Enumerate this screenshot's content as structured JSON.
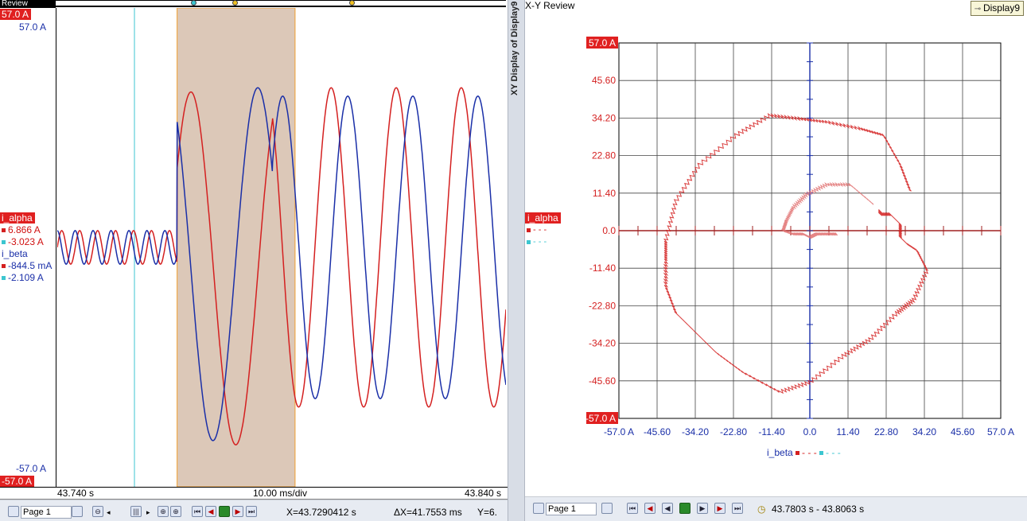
{
  "left_panel": {
    "tab_label": "Review",
    "scale_top_red": "57.0  A",
    "scale_top_blue": "57.0  A",
    "scale_bottom_blue": "-57.0  A",
    "scale_bottom_red": "-57.0  A",
    "channels": [
      {
        "name": "i_alpha",
        "value1": "6.866  A",
        "value2": "-3.023  A"
      },
      {
        "name": "i_beta",
        "value1": "-844.5 mA",
        "value2": "-2.109  A"
      }
    ],
    "time_start": "43.740 s",
    "time_div": "10.00 ms/div",
    "time_end": "43.840 s",
    "toolbar": {
      "page_label": "Page 1",
      "x_readout": "X=43.7290412 s",
      "dx_readout": "ΔX=41.7553 ms",
      "y_readout": "Y=6."
    }
  },
  "splitter": {
    "label": "XY Display of Display9 '"
  },
  "right_panel": {
    "title": "X-Y Review",
    "display_button": "Display9",
    "legend_channel": "i_alpha",
    "legend_dash": "- - -",
    "x_legend": "i_beta",
    "toolbar": {
      "page_label": "Page 1",
      "range_readout": "43.7803 s - 43.8063 s"
    }
  },
  "colors": {
    "alpha": "#d42020",
    "beta": "#1a2fa8",
    "cursor_cyan": "#3cc6d0",
    "selection": "#dcc8b8"
  },
  "chart_data": [
    {
      "type": "line",
      "x_range": [
        43.74,
        43.84
      ],
      "y_range": [
        -57,
        57
      ],
      "cursors": [
        {
          "t": 43.7572
        },
        {
          "t": 43.7667
        },
        {
          "t": 43.793
        }
      ],
      "selection": [
        43.7667,
        43.793
      ],
      "series": [
        {
          "name": "i_alpha",
          "color": "#d42020",
          "segments": [
            {
              "t0": 43.74,
              "t1": 43.7667,
              "amp": 4,
              "period": 0.004,
              "phase": 0.0,
              "offset": 0
            },
            {
              "t0": 43.7667,
              "t1": 43.788,
              "amp": 42,
              "period": 0.02,
              "phase": 0.6,
              "offset": -5
            },
            {
              "t0": 43.788,
              "t1": 43.84,
              "amp": 38,
              "period": 0.0145,
              "phase": 2.2,
              "offset": 0
            }
          ]
        },
        {
          "name": "i_beta",
          "color": "#1a2fa8",
          "segments": [
            {
              "t0": 43.74,
              "t1": 43.7667,
              "amp": 4,
              "period": 0.004,
              "phase": 1.6,
              "offset": 0
            },
            {
              "t0": 43.7667,
              "t1": 43.788,
              "amp": 42,
              "period": 0.02,
              "phase": 2.2,
              "offset": -4
            },
            {
              "t0": 43.788,
              "t1": 43.84,
              "amp": 36,
              "period": 0.0145,
              "phase": 0.6,
              "offset": 0
            }
          ]
        }
      ]
    },
    {
      "type": "scatter",
      "xlabel": "i_beta",
      "ylabel": "i_alpha",
      "xlim": [
        -57,
        57
      ],
      "ylim": [
        -57,
        57
      ],
      "ticks": [
        "-57.0 A",
        "-45.60",
        "-34.20",
        "-22.80",
        "-11.40",
        "0.0",
        "11.40",
        "22.80",
        "34.20",
        "45.60",
        "57.0 A"
      ],
      "tick_values": [
        -57,
        -45.6,
        -34.2,
        -22.8,
        -11.4,
        0,
        11.4,
        22.8,
        34.2,
        45.6,
        57
      ],
      "outer_loop": [
        [
          30,
          12
        ],
        [
          27,
          20
        ],
        [
          22,
          29
        ],
        [
          15,
          31
        ],
        [
          5,
          33
        ],
        [
          -3,
          34
        ],
        [
          -12,
          35
        ],
        [
          -22,
          29
        ],
        [
          -33,
          20
        ],
        [
          -40,
          9
        ],
        [
          -43,
          -3
        ],
        [
          -43,
          -9
        ],
        [
          -43,
          -17
        ],
        [
          -40,
          -25
        ],
        [
          -35,
          -30
        ],
        [
          -28,
          -37
        ],
        [
          -20,
          -43
        ],
        [
          -9,
          -49
        ],
        [
          0,
          -46
        ],
        [
          10,
          -38
        ],
        [
          18,
          -33
        ],
        [
          26,
          -25
        ],
        [
          31,
          -21
        ],
        [
          35,
          -12
        ],
        [
          32,
          -6
        ],
        [
          29,
          -4
        ],
        [
          27,
          -2
        ],
        [
          27,
          2
        ],
        [
          24,
          5
        ],
        [
          21,
          5
        ],
        [
          21,
          6
        ]
      ],
      "inner_loop": [
        [
          19,
          8
        ],
        [
          12,
          14
        ],
        [
          5,
          14
        ],
        [
          -1,
          11
        ],
        [
          -5,
          7
        ],
        [
          -7,
          3
        ],
        [
          -8,
          0
        ],
        [
          -5,
          -1
        ],
        [
          -2,
          -1
        ],
        [
          0,
          -2
        ],
        [
          2,
          -1
        ],
        [
          5,
          -1
        ],
        [
          8,
          -1
        ]
      ]
    }
  ]
}
